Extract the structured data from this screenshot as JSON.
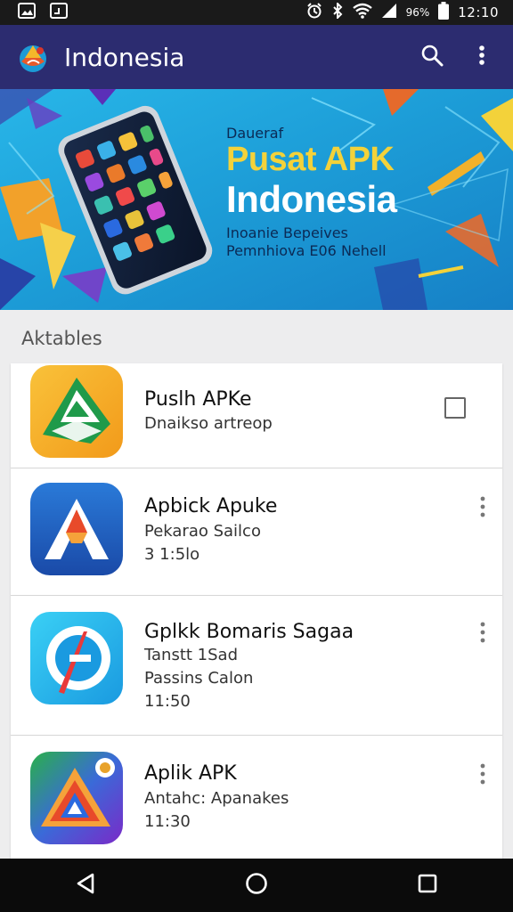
{
  "status_bar": {
    "battery_percent": "96%",
    "time": "12:10"
  },
  "app_bar": {
    "title": "Indonesia",
    "search_icon": "search-icon",
    "more_icon": "more-vert-icon"
  },
  "banner": {
    "small_text": "Daueraf",
    "title": "Pusat APK",
    "subtitle": "Indonesia",
    "line1": "Inoanie Bepeives",
    "line2": "Pemnhiova E06 Nehell"
  },
  "section": {
    "title": "Aktables"
  },
  "apps": [
    {
      "name": "Puslh APKe",
      "lines": [
        "Dnaikso artreop"
      ],
      "action": "checkbox"
    },
    {
      "name": "Apbick Apuke",
      "lines": [
        "Pekarao Sailco",
        "3 1:5lo"
      ],
      "action": "more"
    },
    {
      "name": "Gplkk Bomaris Sagaa",
      "lines": [
        "Tanstt 1Sad",
        "Passins Calon",
        "11:50"
      ],
      "action": "more"
    },
    {
      "name": "Aplik APK",
      "lines": [
        "Antahc: Apanakes",
        "11:30"
      ],
      "action": "more"
    }
  ],
  "nav": {
    "back": "back-icon",
    "home": "home-icon",
    "recents": "recents-icon"
  },
  "colors": {
    "app_bar": "#2c2c70",
    "banner_bg": "#1fa3d9",
    "banner_title": "#f3d23a",
    "status_bar": "#1a1a1a",
    "nav_bar": "#0b0b0b"
  }
}
